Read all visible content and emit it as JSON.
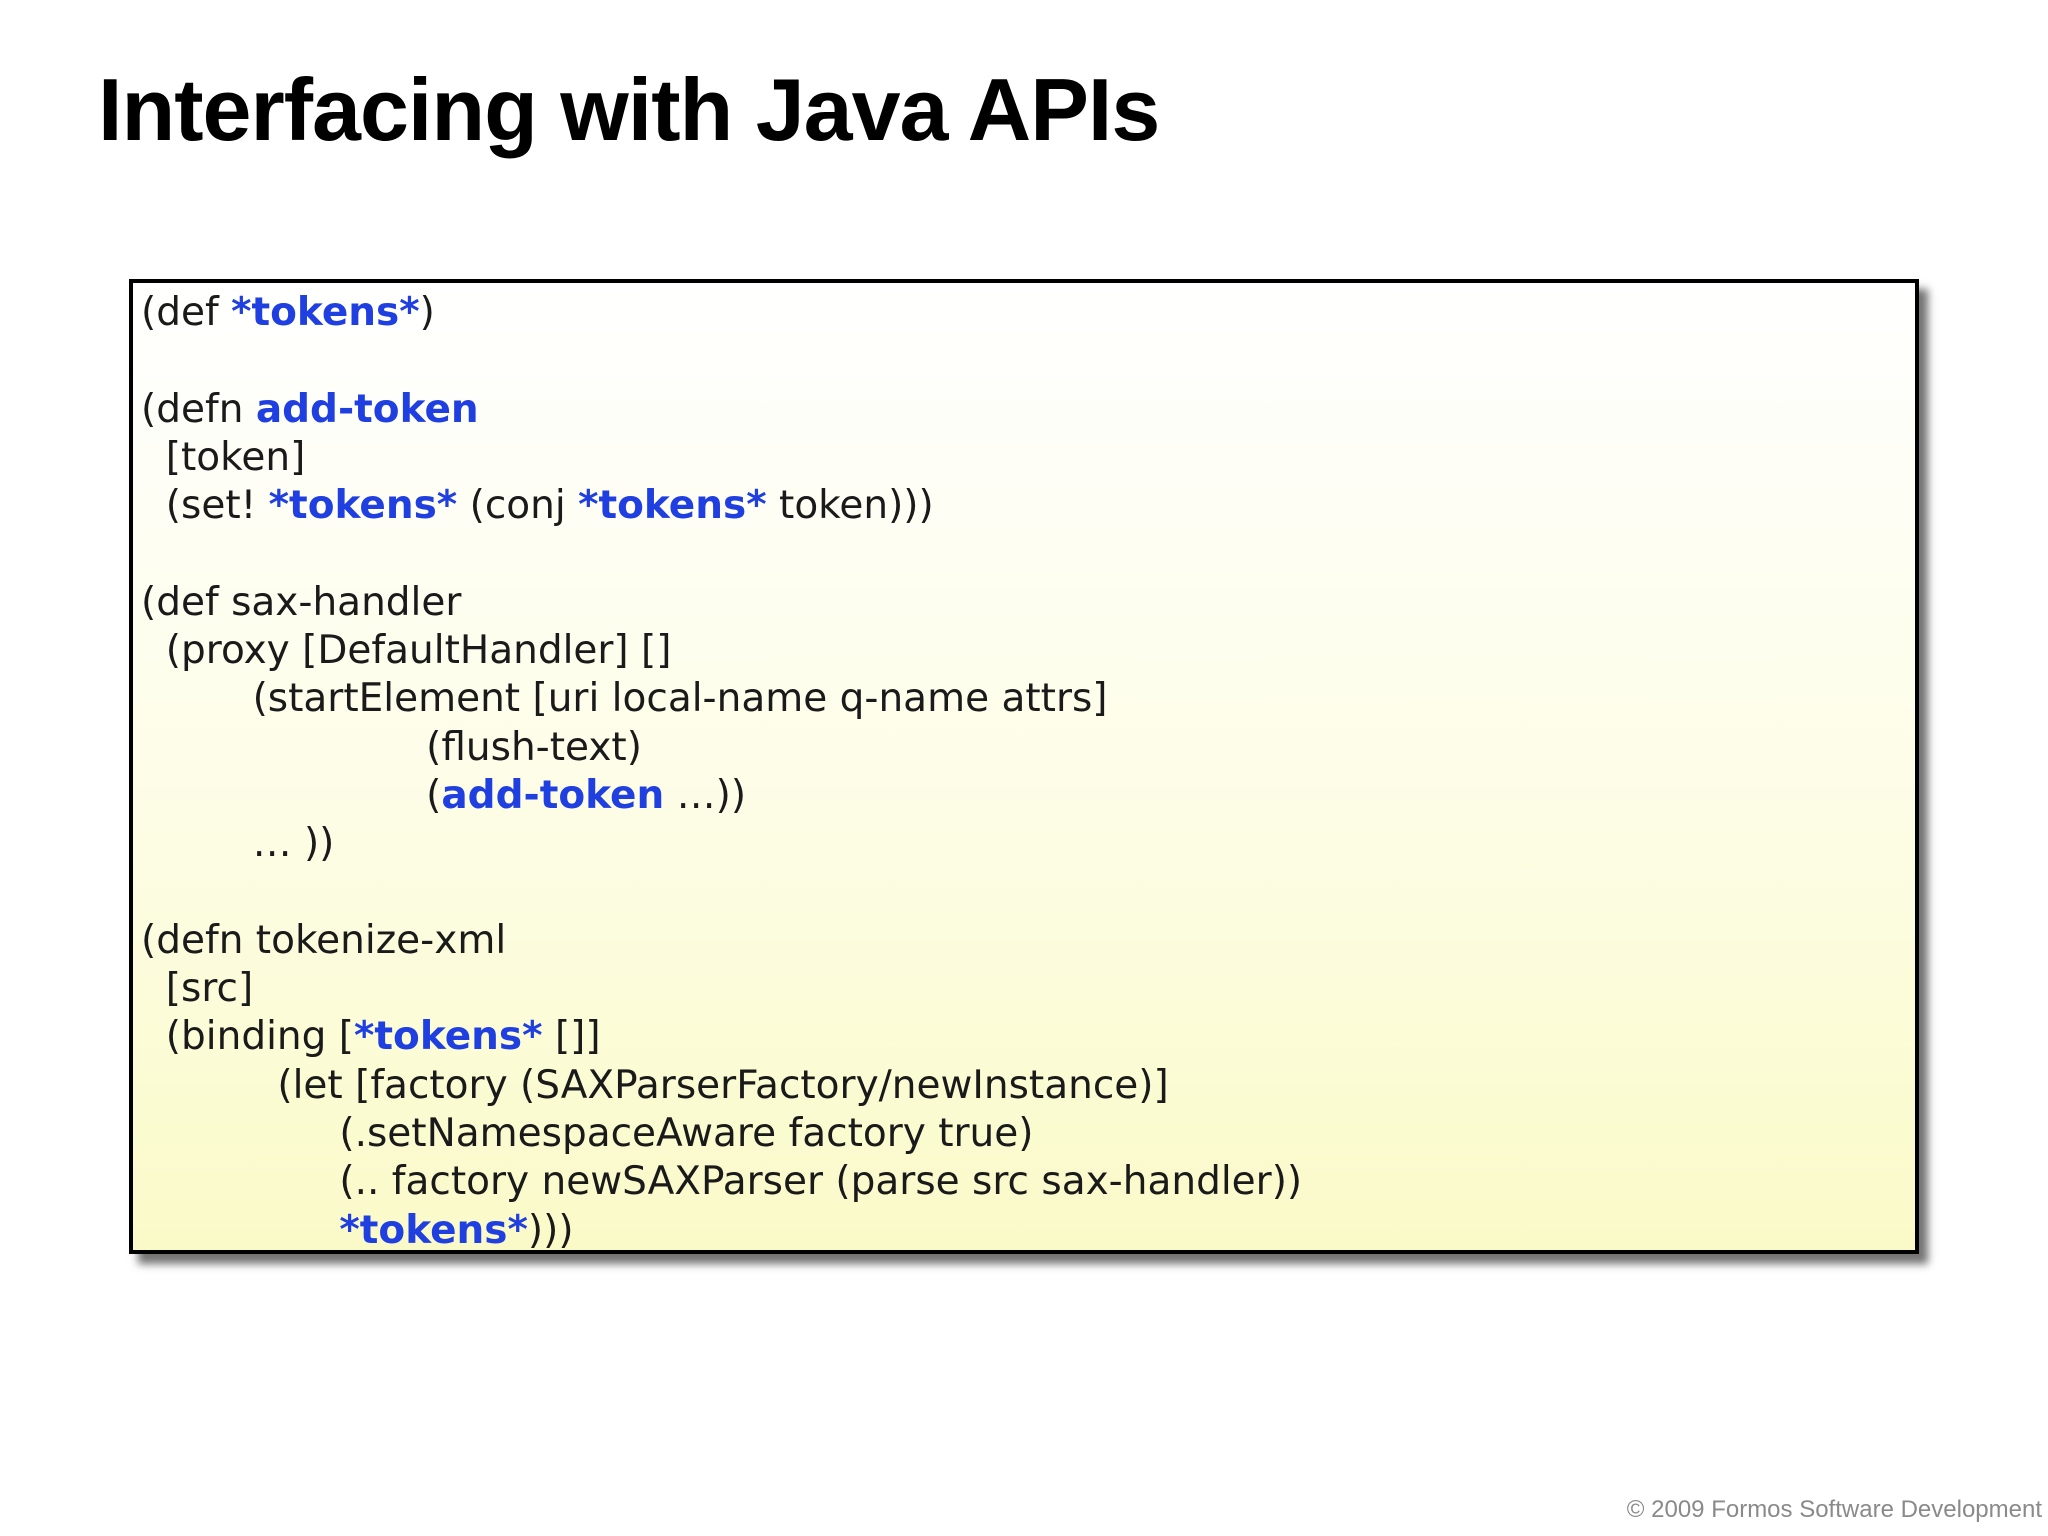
{
  "slide": {
    "title": "Interfacing with Java APIs",
    "copyright": "© 2009 Formos Software Development"
  },
  "colors": {
    "keyword_highlight": "#1f3fe0",
    "code_text": "#1a1a1a",
    "box_gradient_top": "#ffffff",
    "box_gradient_bottom": "#fafac8"
  },
  "code": {
    "lines": [
      [
        {
          "t": "(def "
        },
        {
          "t": "*tokens*",
          "hl": true
        },
        {
          "t": ")"
        }
      ],
      [],
      [
        {
          "t": "(defn "
        },
        {
          "t": "add-token",
          "hl": true
        }
      ],
      [
        {
          "t": "  [token]"
        }
      ],
      [
        {
          "t": "  (set! "
        },
        {
          "t": "*tokens*",
          "hl": true
        },
        {
          "t": " (conj "
        },
        {
          "t": "*tokens*",
          "hl": true
        },
        {
          "t": " token)))"
        }
      ],
      [],
      [
        {
          "t": "(def sax-handler"
        }
      ],
      [
        {
          "t": "  (proxy [DefaultHandler] []"
        }
      ],
      [
        {
          "t": "         (startElement [uri local-name q-name attrs]"
        }
      ],
      [
        {
          "t": "                       (flush-text)"
        }
      ],
      [
        {
          "t": "                       ("
        },
        {
          "t": "add-token",
          "hl": true
        },
        {
          "t": " …))"
        }
      ],
      [
        {
          "t": "         … ))"
        }
      ],
      [],
      [
        {
          "t": "(defn tokenize-xml"
        }
      ],
      [
        {
          "t": "  [src]"
        }
      ],
      [
        {
          "t": "  (binding ["
        },
        {
          "t": "*tokens*",
          "hl": true
        },
        {
          "t": " []]"
        }
      ],
      [
        {
          "t": "           (let [factory (SAXParserFactory/newInstance)]"
        }
      ],
      [
        {
          "t": "                (.setNamespaceAware factory true)"
        }
      ],
      [
        {
          "t": "                (.. factory newSAXParser (parse src sax-handler))"
        }
      ],
      [
        {
          "t": "                "
        },
        {
          "t": "*tokens*",
          "hl": true
        },
        {
          "t": ")))"
        }
      ]
    ]
  }
}
